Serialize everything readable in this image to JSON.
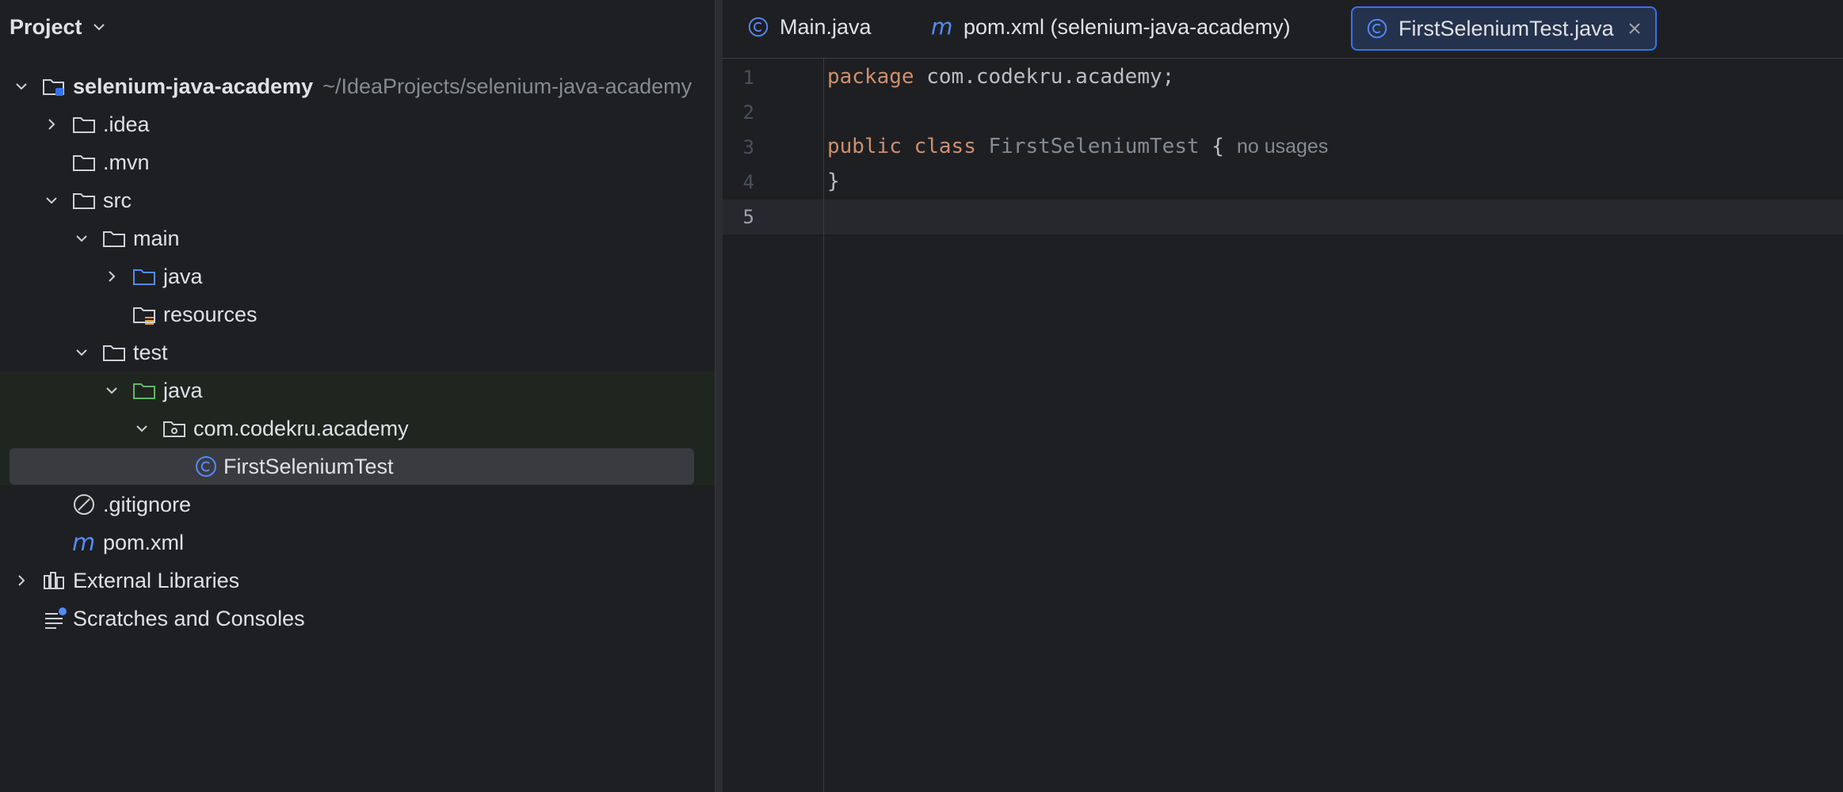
{
  "project_panel": {
    "title": "Project",
    "tree": [
      {
        "label": "selenium-java-academy",
        "hint": "~/IdeaProjects/selenium-java-academy",
        "icon": "module-folder-icon",
        "expanded": true
      },
      {
        "label": ".idea",
        "icon": "folder-icon",
        "expanded": false
      },
      {
        "label": ".mvn",
        "icon": "folder-icon"
      },
      {
        "label": "src",
        "icon": "folder-icon",
        "expanded": true
      },
      {
        "label": "main",
        "icon": "folder-icon",
        "expanded": true
      },
      {
        "label": "java",
        "icon": "source-folder-icon",
        "expanded": false
      },
      {
        "label": "resources",
        "icon": "resources-folder-icon"
      },
      {
        "label": "test",
        "icon": "folder-icon",
        "expanded": true
      },
      {
        "label": "java",
        "icon": "test-source-folder-icon",
        "expanded": true
      },
      {
        "label": "com.codekru.academy",
        "icon": "package-icon",
        "expanded": true
      },
      {
        "label": "FirstSeleniumTest",
        "icon": "java-class-icon",
        "selected": true
      },
      {
        "label": ".gitignore",
        "icon": "gitignore-icon"
      },
      {
        "label": "pom.xml",
        "icon": "maven-icon"
      },
      {
        "label": "External Libraries",
        "icon": "libraries-icon",
        "expanded": false
      },
      {
        "label": "Scratches and Consoles",
        "icon": "scratches-icon"
      }
    ]
  },
  "tabs": [
    {
      "label": "Main.java",
      "icon": "java-class-icon"
    },
    {
      "label": "pom.xml (selenium-java-academy)",
      "icon": "maven-icon"
    },
    {
      "label": "FirstSeleniumTest.java",
      "icon": "java-class-icon",
      "active": true
    }
  ],
  "editor": {
    "line_numbers": [
      "1",
      "2",
      "3",
      "4",
      "5"
    ],
    "current_line": 5,
    "lines": {
      "l1_kw": "package",
      "l1_rest": " com.codekru.academy;",
      "l3_kw1": "public",
      "l3_kw2": "class",
      "l3_name": "FirstSeleniumTest",
      "l3_brace": " {",
      "l3_inlay": "no usages",
      "l4": "}"
    }
  },
  "colors": {
    "background": "#1e1f22",
    "keyword": "#cf8e6d",
    "accent": "#3574f0",
    "selection": "#393b40"
  }
}
